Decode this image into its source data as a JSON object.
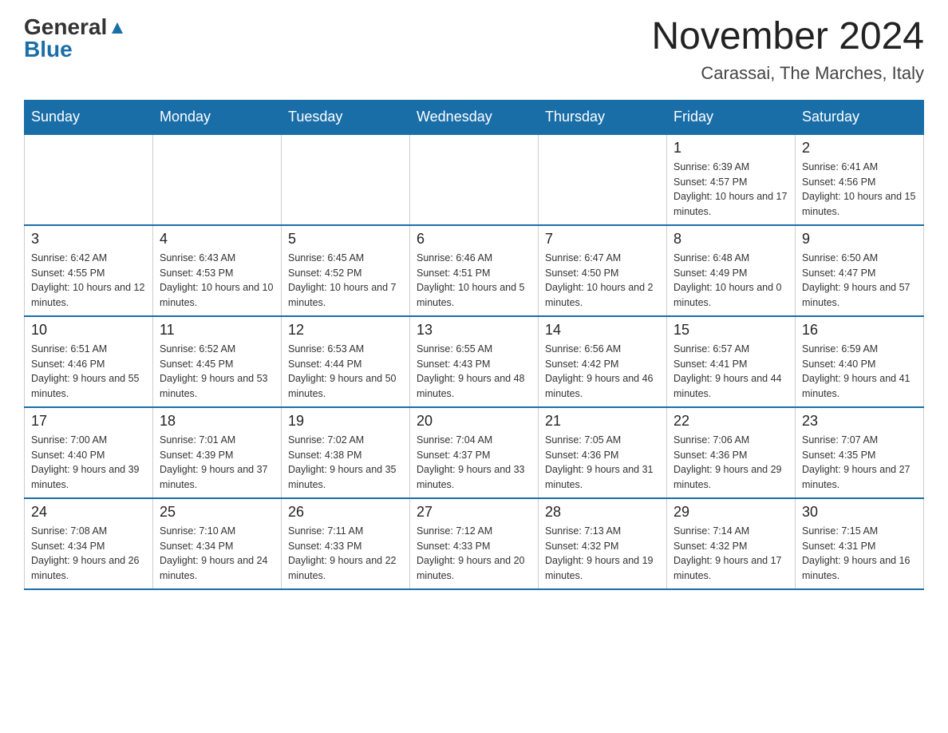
{
  "header": {
    "logo_general": "General",
    "logo_blue": "Blue",
    "month_title": "November 2024",
    "location": "Carassai, The Marches, Italy"
  },
  "weekdays": [
    "Sunday",
    "Monday",
    "Tuesday",
    "Wednesday",
    "Thursday",
    "Friday",
    "Saturday"
  ],
  "weeks": [
    [
      {
        "day": "",
        "info": ""
      },
      {
        "day": "",
        "info": ""
      },
      {
        "day": "",
        "info": ""
      },
      {
        "day": "",
        "info": ""
      },
      {
        "day": "",
        "info": ""
      },
      {
        "day": "1",
        "info": "Sunrise: 6:39 AM\nSunset: 4:57 PM\nDaylight: 10 hours and 17 minutes."
      },
      {
        "day": "2",
        "info": "Sunrise: 6:41 AM\nSunset: 4:56 PM\nDaylight: 10 hours and 15 minutes."
      }
    ],
    [
      {
        "day": "3",
        "info": "Sunrise: 6:42 AM\nSunset: 4:55 PM\nDaylight: 10 hours and 12 minutes."
      },
      {
        "day": "4",
        "info": "Sunrise: 6:43 AM\nSunset: 4:53 PM\nDaylight: 10 hours and 10 minutes."
      },
      {
        "day": "5",
        "info": "Sunrise: 6:45 AM\nSunset: 4:52 PM\nDaylight: 10 hours and 7 minutes."
      },
      {
        "day": "6",
        "info": "Sunrise: 6:46 AM\nSunset: 4:51 PM\nDaylight: 10 hours and 5 minutes."
      },
      {
        "day": "7",
        "info": "Sunrise: 6:47 AM\nSunset: 4:50 PM\nDaylight: 10 hours and 2 minutes."
      },
      {
        "day": "8",
        "info": "Sunrise: 6:48 AM\nSunset: 4:49 PM\nDaylight: 10 hours and 0 minutes."
      },
      {
        "day": "9",
        "info": "Sunrise: 6:50 AM\nSunset: 4:47 PM\nDaylight: 9 hours and 57 minutes."
      }
    ],
    [
      {
        "day": "10",
        "info": "Sunrise: 6:51 AM\nSunset: 4:46 PM\nDaylight: 9 hours and 55 minutes."
      },
      {
        "day": "11",
        "info": "Sunrise: 6:52 AM\nSunset: 4:45 PM\nDaylight: 9 hours and 53 minutes."
      },
      {
        "day": "12",
        "info": "Sunrise: 6:53 AM\nSunset: 4:44 PM\nDaylight: 9 hours and 50 minutes."
      },
      {
        "day": "13",
        "info": "Sunrise: 6:55 AM\nSunset: 4:43 PM\nDaylight: 9 hours and 48 minutes."
      },
      {
        "day": "14",
        "info": "Sunrise: 6:56 AM\nSunset: 4:42 PM\nDaylight: 9 hours and 46 minutes."
      },
      {
        "day": "15",
        "info": "Sunrise: 6:57 AM\nSunset: 4:41 PM\nDaylight: 9 hours and 44 minutes."
      },
      {
        "day": "16",
        "info": "Sunrise: 6:59 AM\nSunset: 4:40 PM\nDaylight: 9 hours and 41 minutes."
      }
    ],
    [
      {
        "day": "17",
        "info": "Sunrise: 7:00 AM\nSunset: 4:40 PM\nDaylight: 9 hours and 39 minutes."
      },
      {
        "day": "18",
        "info": "Sunrise: 7:01 AM\nSunset: 4:39 PM\nDaylight: 9 hours and 37 minutes."
      },
      {
        "day": "19",
        "info": "Sunrise: 7:02 AM\nSunset: 4:38 PM\nDaylight: 9 hours and 35 minutes."
      },
      {
        "day": "20",
        "info": "Sunrise: 7:04 AM\nSunset: 4:37 PM\nDaylight: 9 hours and 33 minutes."
      },
      {
        "day": "21",
        "info": "Sunrise: 7:05 AM\nSunset: 4:36 PM\nDaylight: 9 hours and 31 minutes."
      },
      {
        "day": "22",
        "info": "Sunrise: 7:06 AM\nSunset: 4:36 PM\nDaylight: 9 hours and 29 minutes."
      },
      {
        "day": "23",
        "info": "Sunrise: 7:07 AM\nSunset: 4:35 PM\nDaylight: 9 hours and 27 minutes."
      }
    ],
    [
      {
        "day": "24",
        "info": "Sunrise: 7:08 AM\nSunset: 4:34 PM\nDaylight: 9 hours and 26 minutes."
      },
      {
        "day": "25",
        "info": "Sunrise: 7:10 AM\nSunset: 4:34 PM\nDaylight: 9 hours and 24 minutes."
      },
      {
        "day": "26",
        "info": "Sunrise: 7:11 AM\nSunset: 4:33 PM\nDaylight: 9 hours and 22 minutes."
      },
      {
        "day": "27",
        "info": "Sunrise: 7:12 AM\nSunset: 4:33 PM\nDaylight: 9 hours and 20 minutes."
      },
      {
        "day": "28",
        "info": "Sunrise: 7:13 AM\nSunset: 4:32 PM\nDaylight: 9 hours and 19 minutes."
      },
      {
        "day": "29",
        "info": "Sunrise: 7:14 AM\nSunset: 4:32 PM\nDaylight: 9 hours and 17 minutes."
      },
      {
        "day": "30",
        "info": "Sunrise: 7:15 AM\nSunset: 4:31 PM\nDaylight: 9 hours and 16 minutes."
      }
    ]
  ]
}
